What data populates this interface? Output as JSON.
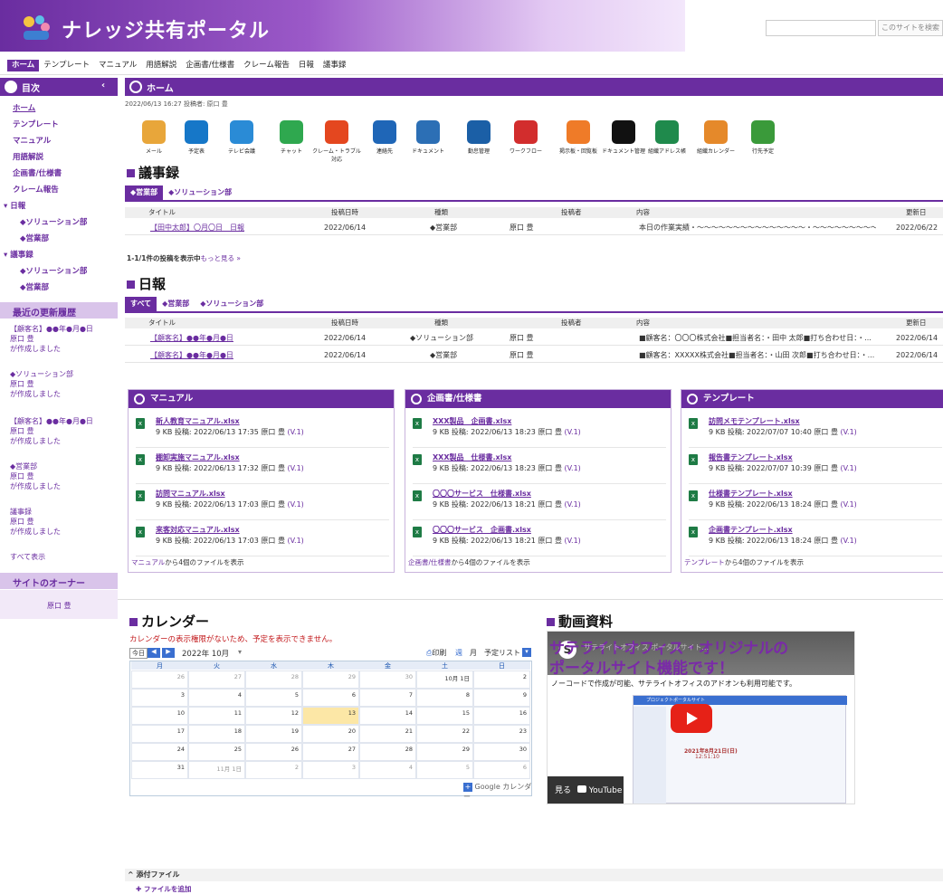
{
  "header": {
    "title": "ナレッジ共有ポータル",
    "search_button": "このサイトを検索",
    "search_placeholder": ""
  },
  "topnav": [
    "ホーム",
    "テンプレート",
    "マニュアル",
    "用語解説",
    "企画書/仕様書",
    "クレーム報告",
    "日報",
    "議事録"
  ],
  "sidebar": {
    "title": "目次",
    "items": [
      "ホーム",
      "テンプレート",
      "マニュアル",
      "用語解説",
      "企画書/仕様書",
      "クレーム報告",
      "日報",
      "◆ソリューション部",
      "◆営業部",
      "議事録",
      "◆ソリューション部",
      "◆営業部"
    ],
    "updates_title": "最近の更新履歴",
    "updates": [
      {
        "l1": "【顧客名】●●年●月●日",
        "l2": "原口 豊",
        "l3": "が作成しました"
      },
      {
        "l1": "◆ソリューション部",
        "l2": "原口 豊",
        "l3": "が作成しました"
      },
      {
        "l1": "【顧客名】●●年●月●日",
        "l2": "原口 豊",
        "l3": "が作成しました"
      },
      {
        "l1": "◆営業部",
        "l2": "原口 豊",
        "l3": "が作成しました"
      },
      {
        "l1": "議事録",
        "l2": "原口 豊",
        "l3": "が作成しました"
      }
    ],
    "show_all": "すべて表示",
    "owner_title": "サイトのオーナー",
    "owner": "原口 豊"
  },
  "main": {
    "title": "ホーム",
    "meta": "2022/06/13 16:27 投稿者: 原口 豊",
    "apps": [
      {
        "label": "メール",
        "color": "#e8a63a",
        "icon": "mail-icon"
      },
      {
        "label": "予定表",
        "color": "#1677c8",
        "icon": "calendar-grid-icon"
      },
      {
        "label": "テレビ会議",
        "color": "#2a8bd6",
        "icon": "video-icon"
      },
      {
        "label": "チャット",
        "color": "#2fa84f",
        "icon": "chat-icon"
      },
      {
        "label": "クレーム・トラブル対応",
        "color": "#e4471f",
        "icon": "alert-icon"
      },
      {
        "label": "連絡先",
        "color": "#1f66b7",
        "icon": "contact-icon"
      },
      {
        "label": "ドキュメント",
        "color": "#2c6fb5",
        "icon": "document-icon"
      },
      {
        "label": "勤怠管理",
        "color": "#1b5fa6",
        "icon": "attendance-icon"
      },
      {
        "label": "ワークフロー",
        "color": "#d22d2d",
        "icon": "workflow-icon"
      },
      {
        "label": "掲示板・回覧板",
        "color": "#ef7b28",
        "icon": "board-icon"
      },
      {
        "label": "ドキュメント管理",
        "color": "#111111",
        "icon": "doc-manage-icon"
      },
      {
        "label": "組織アドレス帳",
        "color": "#1f8a4c",
        "icon": "addressbook-icon"
      },
      {
        "label": "組織カレンダー",
        "color": "#e5892a",
        "icon": "org-calendar-icon"
      },
      {
        "label": "行先予定",
        "color": "#3a9a3a",
        "icon": "destination-icon"
      }
    ],
    "minutes": {
      "title": "議事録",
      "tabs": [
        "◆営業部",
        "◆ソリューション部"
      ],
      "columns": [
        "タイトル",
        "投稿日時",
        "種類",
        "投稿者",
        "内容",
        "更新日"
      ],
      "rows": [
        [
          "【田中太郎】〇月〇日　日報",
          "2022/06/14",
          "◆営業部",
          "原口 豊",
          "本日の作業実績・〜〜〜〜〜〜〜〜〜〜〜〜〜〜〜・〜〜〜〜〜〜〜〜〜〜...",
          "2022/06/22"
        ]
      ],
      "footer_prefix": "1-1/1件の投稿を表示中",
      "footer_link": "もっと見る »"
    },
    "daily": {
      "title": "日報",
      "tabs": [
        "すべて",
        "◆営業部",
        "◆ソリューション部"
      ],
      "columns": [
        "タイトル",
        "投稿日時",
        "種類",
        "投稿者",
        "内容",
        "更新日"
      ],
      "rows": [
        [
          "【顧客名】●●年●月●日",
          "2022/06/14",
          "◆ソリューション部",
          "原口 豊",
          "■顧客名：〇〇〇株式会社■担当者名：・田中 太郎■打ち合わせ日：・...",
          "2022/06/14"
        ],
        [
          "【顧客名】●●年●月●日",
          "2022/06/14",
          "◆営業部",
          "原口 豊",
          "■顧客名：XXXXX株式会社■担当者名：・山田 次郎■打ち合わせ日：・...",
          "2022/06/14"
        ]
      ]
    },
    "panels": [
      {
        "title": "マニュアル",
        "files": [
          {
            "name": "新人教育マニュアル.xlsx",
            "meta": "9 KB  投稿: 2022/06/13 17:35 原口 豊 ",
            "ver": "(V.1)"
          },
          {
            "name": "棚卸実施マニュアル.xlsx",
            "meta": "9 KB  投稿: 2022/06/13 17:32 原口 豊 ",
            "ver": "(V.1)"
          },
          {
            "name": "訪問マニュアル.xlsx",
            "meta": "9 KB  投稿: 2022/06/13 17:03 原口 豊 ",
            "ver": "(V.1)"
          },
          {
            "name": "来客対応マニュアル.xlsx",
            "meta": "9 KB  投稿: 2022/06/13 17:03 原口 豊 ",
            "ver": "(V.1)"
          }
        ],
        "foot_link": "マニュアル",
        "foot": "から4個のファイルを表示"
      },
      {
        "title": "企画書/仕様書",
        "files": [
          {
            "name": "XXX製品　企画書.xlsx",
            "meta": "9 KB  投稿: 2022/06/13 18:23 原口 豊 ",
            "ver": "(V.1)"
          },
          {
            "name": "XXX製品　仕様書.xlsx",
            "meta": "9 KB  投稿: 2022/06/13 18:23 原口 豊 ",
            "ver": "(V.1)"
          },
          {
            "name": "〇〇〇サービス　仕様書.xlsx",
            "meta": "9 KB  投稿: 2022/06/13 18:21 原口 豊 ",
            "ver": "(V.1)"
          },
          {
            "name": "〇〇〇サービス　企画書.xlsx",
            "meta": "9 KB  投稿: 2022/06/13 18:21 原口 豊 ",
            "ver": "(V.1)"
          }
        ],
        "foot_link": "企画書/仕様書",
        "foot": "から4個のファイルを表示"
      },
      {
        "title": "テンプレート",
        "files": [
          {
            "name": "訪問メモテンプレート.xlsx",
            "meta": "9 KB  投稿: 2022/07/07 10:40 原口 豊 ",
            "ver": "(V.1)"
          },
          {
            "name": "報告書テンプレート.xlsx",
            "meta": "9 KB  投稿: 2022/07/07 10:39 原口 豊 ",
            "ver": "(V.1)"
          },
          {
            "name": "仕様書テンプレート.xlsx",
            "meta": "9 KB  投稿: 2022/06/13 18:24 原口 豊 ",
            "ver": "(V.1)"
          },
          {
            "name": "企画書テンプレート.xlsx",
            "meta": "9 KB  投稿: 2022/06/13 18:24 原口 豊 ",
            "ver": "(V.1)"
          }
        ],
        "foot_link": "テンプレート",
        "foot": "から4個のファイルを表示"
      }
    ],
    "calendar": {
      "title": "カレンダー",
      "warning": "カレンダーの表示権限がないため、予定を表示できません。",
      "today_btn": "今日",
      "month_label": "2022年 10月",
      "print": "印刷",
      "views": [
        "週",
        "月",
        "予定リスト"
      ],
      "weekdays": [
        "月",
        "火",
        "水",
        "木",
        "金",
        "土",
        "日"
      ],
      "weeks": [
        [
          "26",
          "27",
          "28",
          "29",
          "30",
          "10月 1日",
          "2"
        ],
        [
          "3",
          "4",
          "5",
          "6",
          "7",
          "8",
          "9"
        ],
        [
          "10",
          "11",
          "12",
          "13",
          "14",
          "15",
          "16"
        ],
        [
          "17",
          "18",
          "19",
          "20",
          "21",
          "22",
          "23"
        ],
        [
          "24",
          "25",
          "26",
          "27",
          "28",
          "29",
          "30"
        ],
        [
          "31",
          "11月 1日",
          "2",
          "3",
          "4",
          "5",
          "6"
        ]
      ],
      "google": "Google カレンダー"
    },
    "video": {
      "title": "動画資料",
      "headline1": "サテライトオフィス・オリジナルの",
      "headline2": "ポータルサイト機能です！",
      "channel": "サテライトオフィス ポータルサイト...",
      "sub": "ノーコードで作成が可能、サテライトオフィスのアドオンも利用可能です。",
      "watch": "見る",
      "youtube": "YouTube",
      "thumb_title": "プロジェクトポータルサイト",
      "thumb_date": "2021年8月21日(日)",
      "thumb_time": "12:51:10"
    },
    "attachments": {
      "title": "添付ファイル",
      "add": "ファイルを追加"
    }
  }
}
